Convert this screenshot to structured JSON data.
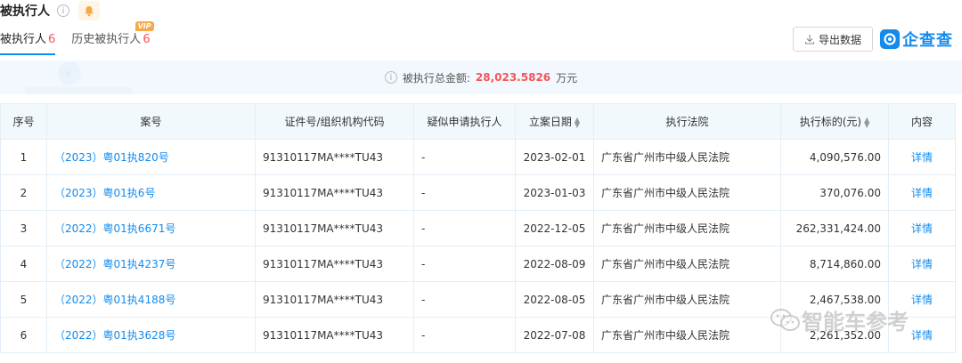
{
  "header": {
    "title": "被执行人",
    "info_icon": "info-circle-icon",
    "bell_icon": "bell-icon"
  },
  "tabs": [
    {
      "label": "被执行人",
      "count": "6",
      "active": true
    },
    {
      "label": "历史被执行人",
      "count": "6",
      "badge": "VIP"
    }
  ],
  "toolbar": {
    "export_label": "导出数据",
    "brand_name": "企查查"
  },
  "summary": {
    "label": "被执行总金额:",
    "amount": "28,023.5826",
    "unit": "万元"
  },
  "table": {
    "columns": [
      "序号",
      "案号",
      "证件号/组织机构代码",
      "疑似申请执行人",
      "立案日期",
      "执行法院",
      "执行标的(元)",
      "内容"
    ],
    "rows": [
      {
        "no": "1",
        "case": "（2023）粤01执820号",
        "id": "91310117MA****TU43",
        "applicant": "-",
        "date": "2023-02-01",
        "court": "广东省广州市中级人民法院",
        "amount": "4,090,576.00",
        "detail": "详情"
      },
      {
        "no": "2",
        "case": "（2023）粤01执6号",
        "id": "91310117MA****TU43",
        "applicant": "-",
        "date": "2023-01-03",
        "court": "广东省广州市中级人民法院",
        "amount": "370,076.00",
        "detail": "详情"
      },
      {
        "no": "3",
        "case": "（2022）粤01执6671号",
        "id": "91310117MA****TU43",
        "applicant": "-",
        "date": "2022-12-05",
        "court": "广东省广州市中级人民法院",
        "amount": "262,331,424.00",
        "detail": "详情"
      },
      {
        "no": "4",
        "case": "（2022）粤01执4237号",
        "id": "91310117MA****TU43",
        "applicant": "-",
        "date": "2022-08-09",
        "court": "广东省广州市中级人民法院",
        "amount": "8,714,860.00",
        "detail": "详情"
      },
      {
        "no": "5",
        "case": "（2022）粤01执4188号",
        "id": "91310117MA****TU43",
        "applicant": "-",
        "date": "2022-08-05",
        "court": "广东省广州市中级人民法院",
        "amount": "2,467,538.00",
        "detail": "详情"
      },
      {
        "no": "6",
        "case": "（2022）粤01执3628号",
        "id": "91310117MA****TU43",
        "applicant": "-",
        "date": "2022-07-08",
        "court": "广东省广州市中级人民法院",
        "amount": "2,261,352.00",
        "detail": "详情"
      }
    ]
  },
  "watermark": {
    "text": "智能车参考",
    "icon": "wechat-icon"
  },
  "colors": {
    "accent": "#128bed",
    "amount_red": "#f2555a",
    "header_bg": "#f2f9fc",
    "summary_bg": "#f3f8fe"
  }
}
